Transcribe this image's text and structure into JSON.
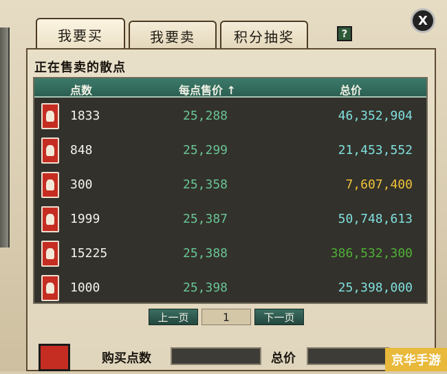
{
  "tabs": [
    {
      "label": "我要买"
    },
    {
      "label": "我要卖"
    },
    {
      "label": "积分抽奖"
    }
  ],
  "help_label": "?",
  "close_label": "X",
  "section_title": "正在售卖的散点",
  "table": {
    "headers": {
      "qty": "点数",
      "price": "每点售价 ↑",
      "total": "总价"
    },
    "rows": [
      {
        "qty": "1833",
        "price": "25,288",
        "total": "46,352,904",
        "total_color": "#7fe0e0"
      },
      {
        "qty": "848",
        "price": "25,299",
        "total": "21,453,552",
        "total_color": "#7fe0e0"
      },
      {
        "qty": "300",
        "price": "25,358",
        "total": "7,607,400",
        "total_color": "#f0c23c"
      },
      {
        "qty": "1999",
        "price": "25,387",
        "total": "50,748,613",
        "total_color": "#7fe0e0"
      },
      {
        "qty": "15225",
        "price": "25,388",
        "total": "386,532,300",
        "total_color": "#4fb038"
      },
      {
        "qty": "1000",
        "price": "25,398",
        "total": "25,398,000",
        "total_color": "#7fe0e0"
      }
    ]
  },
  "pager": {
    "prev_label": "上一页",
    "page": "1",
    "next_label": "下一页"
  },
  "purchase": {
    "qty_label": "购买点数",
    "qty_value": "",
    "total_label": "总价",
    "total_value": ""
  },
  "watermark": "京华手游"
}
